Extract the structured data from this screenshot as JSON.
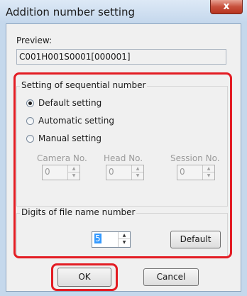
{
  "window": {
    "title": "Addition number setting",
    "close_label": "x"
  },
  "preview": {
    "label": "Preview:",
    "value": "C001H001S0001[000001]"
  },
  "sequential": {
    "legend": "Setting of sequential number",
    "options": [
      {
        "label": "Default setting",
        "selected": true
      },
      {
        "label": "Automatic setting",
        "selected": false
      },
      {
        "label": "Manual setting",
        "selected": false
      }
    ],
    "fields": [
      {
        "label": "Camera No.",
        "value": "0"
      },
      {
        "label": "Head No.",
        "value": "0"
      },
      {
        "label": "Session No.",
        "value": "0"
      }
    ]
  },
  "digits": {
    "legend": "Digits of file name number",
    "value": "5",
    "default_label": "Default"
  },
  "buttons": {
    "ok_label": "OK",
    "cancel_label": "Cancel"
  },
  "colors": {
    "highlight": "#e31c23",
    "close": "#c7503c"
  }
}
